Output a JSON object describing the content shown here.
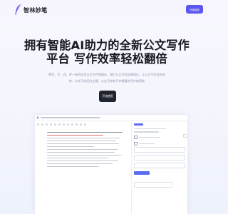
{
  "header": {
    "brand": "智林妙笔",
    "cta": "开始使用",
    "accent": "#5b56f0"
  },
  "hero": {
    "title_line1": "拥有智能AI助力的全新公文写作",
    "title_line2": "平台 写作效率轻松翻倍",
    "description": "撰写、写、润、评一体的应用公文写作等服务，我们公文写作区做到位。让公文写作区的好的…公文写作区的主题，公文写作助手你需要的写作的帮助",
    "cta": "开始使用",
    "cta_color": "#20242e"
  },
  "preview": {
    "icon": "document-icon"
  }
}
